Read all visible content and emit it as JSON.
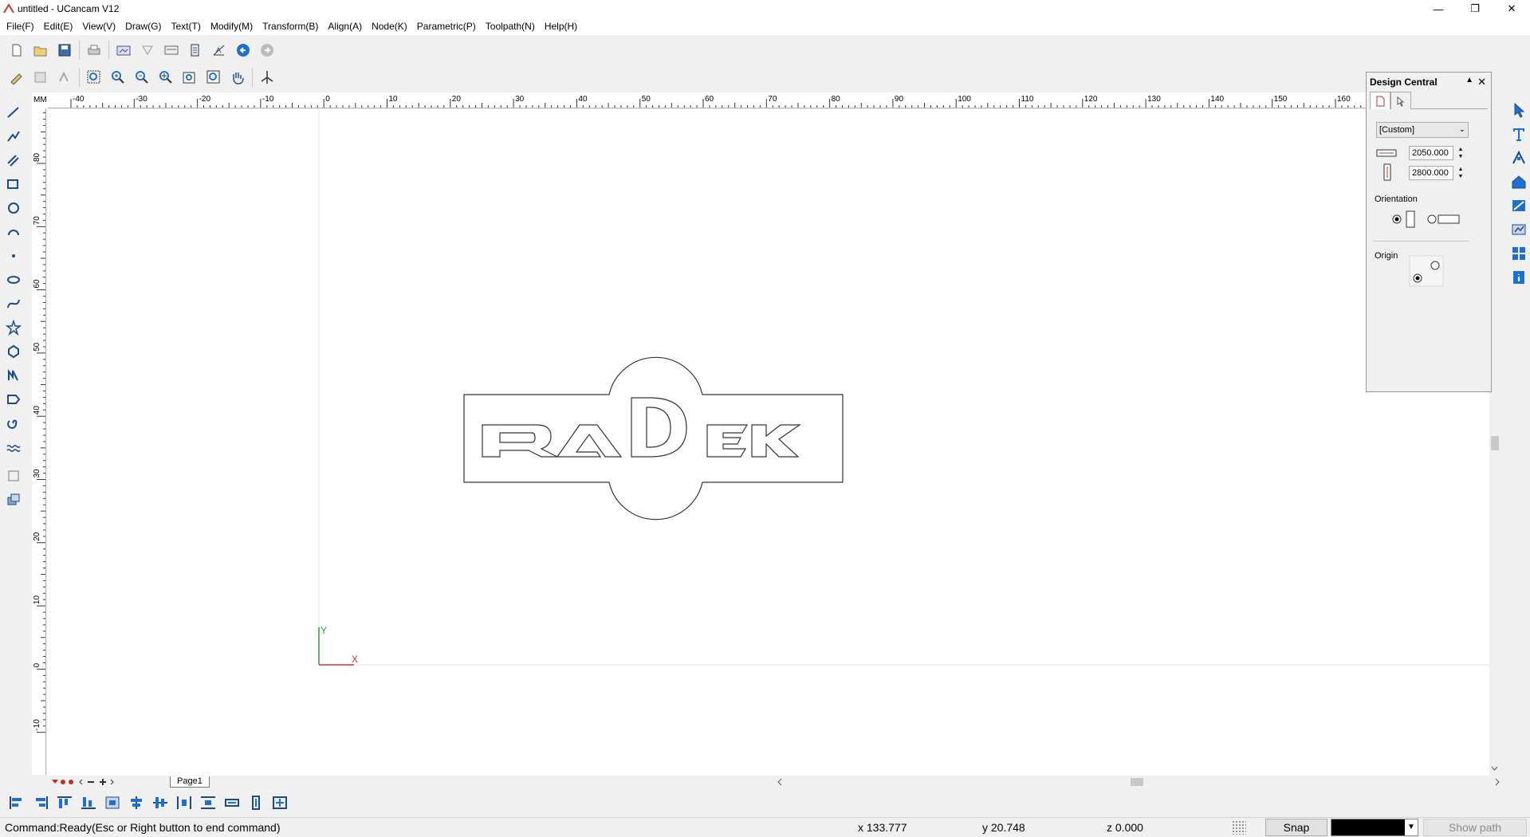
{
  "window": {
    "title": "untitled - UCancam V12"
  },
  "menu": [
    "File(F)",
    "Edit(E)",
    "View(V)",
    "Draw(G)",
    "Text(T)",
    "Modify(M)",
    "Transform(B)",
    "Align(A)",
    "Node(K)",
    "Parametric(P)",
    "Toolpath(N)",
    "Help(H)"
  ],
  "ruler": {
    "unit": "MM",
    "h_ticks": [
      "-40",
      "-30",
      "-20",
      "-10",
      "0",
      "10",
      "20",
      "30",
      "40",
      "50",
      "60",
      "70",
      "80",
      "90",
      "100",
      "110",
      "120",
      "130",
      "140",
      "150",
      "160"
    ],
    "v_ticks": [
      "80",
      "70",
      "60",
      "50",
      "40",
      "30",
      "20",
      "10",
      "0",
      "-10"
    ]
  },
  "canvas": {
    "logo_text": "RADEK",
    "axis_x": "X",
    "axis_y": "Y"
  },
  "tabs": {
    "page": "Page1"
  },
  "design_central": {
    "title": "Design Central",
    "preset": "[Custom]",
    "width": "2050.000",
    "height": "2800.000",
    "orientation_label": "Orientation",
    "origin_label": "Origin"
  },
  "status": {
    "command": "Command:Ready(Esc or Right button to end command)",
    "x": "x 133.777",
    "y": "y 20.748",
    "z": "z 0.000",
    "snap": "Snap",
    "show_path": "Show path"
  },
  "colors": {
    "accent_blue": "#1e6fd0",
    "dark_blue": "#1a4a8a",
    "x_axis": "#d03030",
    "y_axis": "#2aa02a"
  }
}
